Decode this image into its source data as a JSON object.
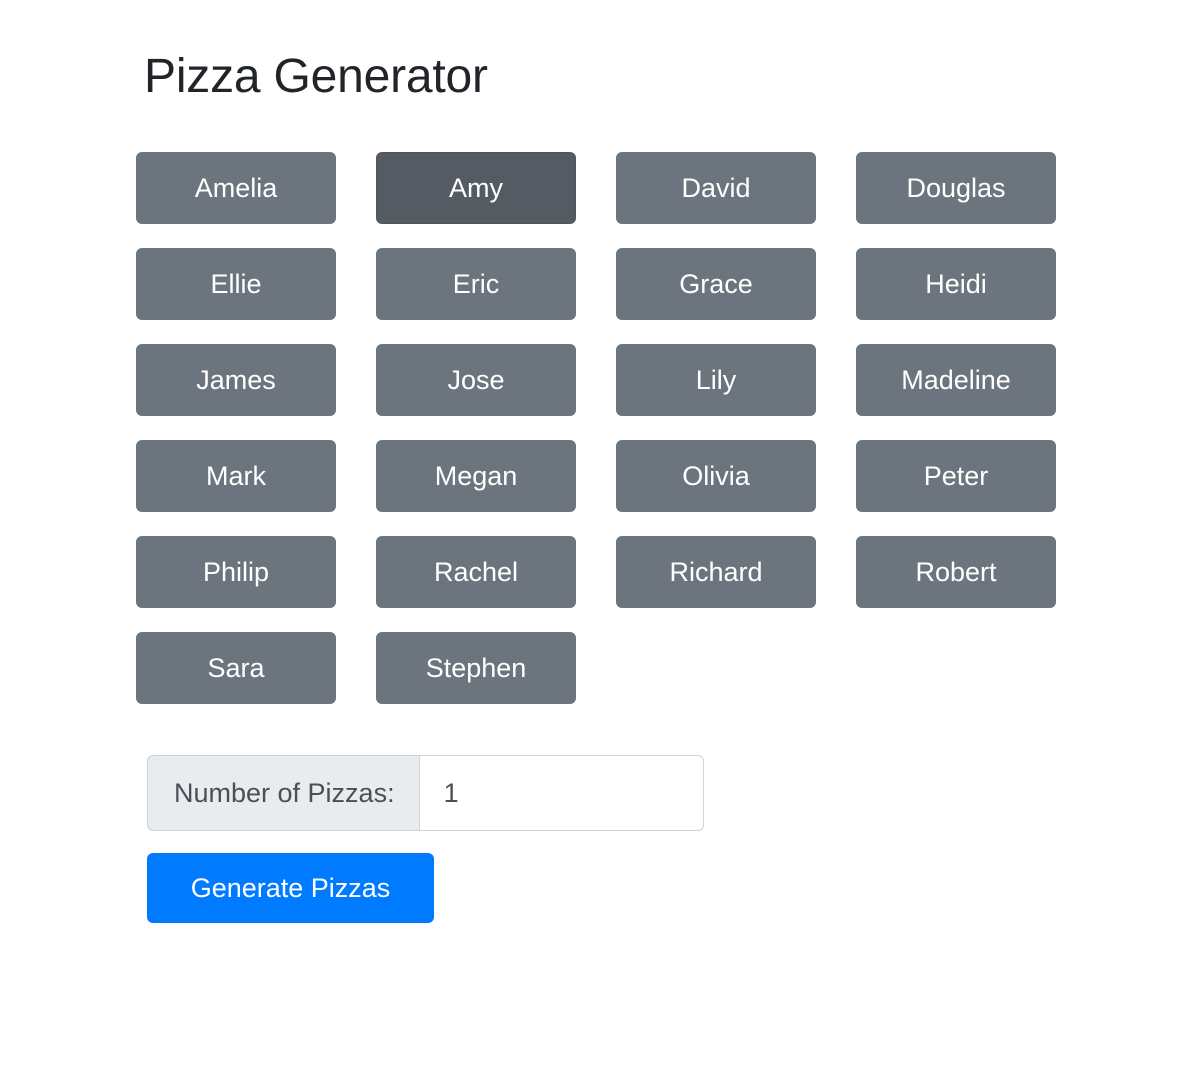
{
  "app": {
    "title": "Pizza Generator",
    "background_color": "#ffffff",
    "title_color": "#212529"
  },
  "colors": {
    "name_button": "#6c757d",
    "name_button_active": "#545b62",
    "primary_button": "#007bff",
    "input_prepend_bg": "#e9ecef",
    "input_border": "#ced4da",
    "input_text": "#495057"
  },
  "name_buttons": {
    "columns": 4,
    "items": [
      {
        "label": "Amelia",
        "selected": false
      },
      {
        "label": "Amy",
        "selected": true
      },
      {
        "label": "David",
        "selected": false
      },
      {
        "label": "Douglas",
        "selected": false
      },
      {
        "label": "Ellie",
        "selected": false
      },
      {
        "label": "Eric",
        "selected": false
      },
      {
        "label": "Grace",
        "selected": false
      },
      {
        "label": "Heidi",
        "selected": false
      },
      {
        "label": "James",
        "selected": false
      },
      {
        "label": "Jose",
        "selected": false
      },
      {
        "label": "Lily",
        "selected": false
      },
      {
        "label": "Madeline",
        "selected": false
      },
      {
        "label": "Mark",
        "selected": false
      },
      {
        "label": "Megan",
        "selected": false
      },
      {
        "label": "Olivia",
        "selected": false
      },
      {
        "label": "Peter",
        "selected": false
      },
      {
        "label": "Philip",
        "selected": false
      },
      {
        "label": "Rachel",
        "selected": false
      },
      {
        "label": "Richard",
        "selected": false
      },
      {
        "label": "Robert",
        "selected": false
      },
      {
        "label": "Sara",
        "selected": false
      },
      {
        "label": "Stephen",
        "selected": false
      }
    ]
  },
  "pizza_count": {
    "label": "Number of Pizzas:",
    "value": "1",
    "placeholder": ""
  },
  "generate": {
    "label": "Generate Pizzas"
  }
}
